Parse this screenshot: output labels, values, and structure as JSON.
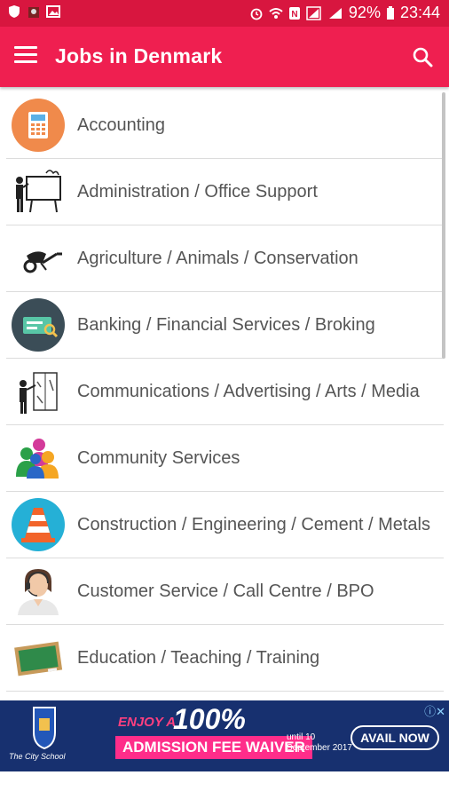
{
  "status_bar": {
    "battery": "92%",
    "time": "23:44",
    "icons": [
      "shield-icon",
      "rabbit-icon",
      "image-icon",
      "alarm-icon",
      "wifi-icon",
      "nfc-icon",
      "signal-icon",
      "battery-icon"
    ]
  },
  "app_bar": {
    "title": "Jobs in Denmark",
    "menu_icon": "hamburger-icon",
    "search_icon": "search-icon",
    "color": "#ef1f50"
  },
  "categories": [
    {
      "label": "Accounting",
      "icon": "calculator-icon"
    },
    {
      "label": "Administration / Office Support",
      "icon": "presentation-icon"
    },
    {
      "label": "Agriculture / Animals / Conservation",
      "icon": "wheelbarrow-icon"
    },
    {
      "label": "Banking / Financial Services / Broking",
      "icon": "credit-card-icon"
    },
    {
      "label": "Communications / Advertising / Arts / Media",
      "icon": "painter-icon"
    },
    {
      "label": "Community Services",
      "icon": "people-icon"
    },
    {
      "label": "Construction / Engineering / Cement / Metals",
      "icon": "traffic-cone-icon"
    },
    {
      "label": "Customer Service / Call Centre / BPO",
      "icon": "headset-agent-icon"
    },
    {
      "label": "Education / Teaching / Training",
      "icon": "chalkboard-icon"
    }
  ],
  "ad": {
    "school": "The City School",
    "enjoy": "ENJOY A",
    "percent": "100%",
    "waiver": "ADMISSION FEE WAIVER",
    "until": "until 10 September 2017",
    "button": "AVAIL NOW"
  }
}
